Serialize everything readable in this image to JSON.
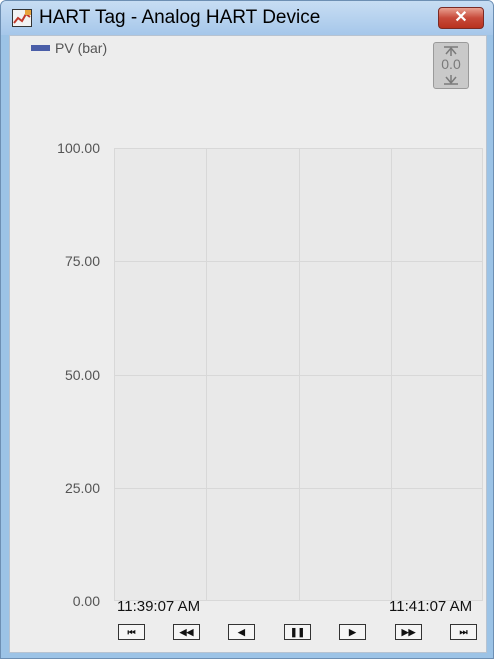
{
  "window": {
    "title": "HART Tag - Analog HART Device",
    "close_glyph": "✕",
    "icon": "chart-app-icon"
  },
  "legend": {
    "label": "PV (bar)",
    "color": "#4a5ea8"
  },
  "zoom": {
    "label": "0.0",
    "icon": "fit-vertical-icon"
  },
  "chart_data": {
    "type": "line",
    "ylabel": "",
    "xlabel": "",
    "ylim": [
      0,
      100
    ],
    "y_ticks": [
      "100.00",
      "75.00",
      "50.00",
      "25.00",
      "0.00"
    ],
    "x_ticks": [
      "11:39:07 AM",
      "11:41:07 AM"
    ],
    "series": [
      {
        "name": "PV (bar)",
        "x": [],
        "y": []
      }
    ],
    "grid": true
  },
  "navigation": {
    "buttons": [
      {
        "name": "first",
        "glyph": "⏮",
        "icon": "skip-to-start-icon"
      },
      {
        "name": "fast-back",
        "glyph": "◀◀",
        "icon": "fast-rewind-icon"
      },
      {
        "name": "back",
        "glyph": "◀",
        "icon": "step-back-icon"
      },
      {
        "name": "pause",
        "glyph": "❚❚",
        "icon": "pause-icon"
      },
      {
        "name": "forward",
        "glyph": "▶",
        "icon": "step-forward-icon"
      },
      {
        "name": "fast-forward",
        "glyph": "▶▶",
        "icon": "fast-forward-icon"
      },
      {
        "name": "last",
        "glyph": "⏭",
        "icon": "skip-to-end-icon"
      }
    ]
  }
}
